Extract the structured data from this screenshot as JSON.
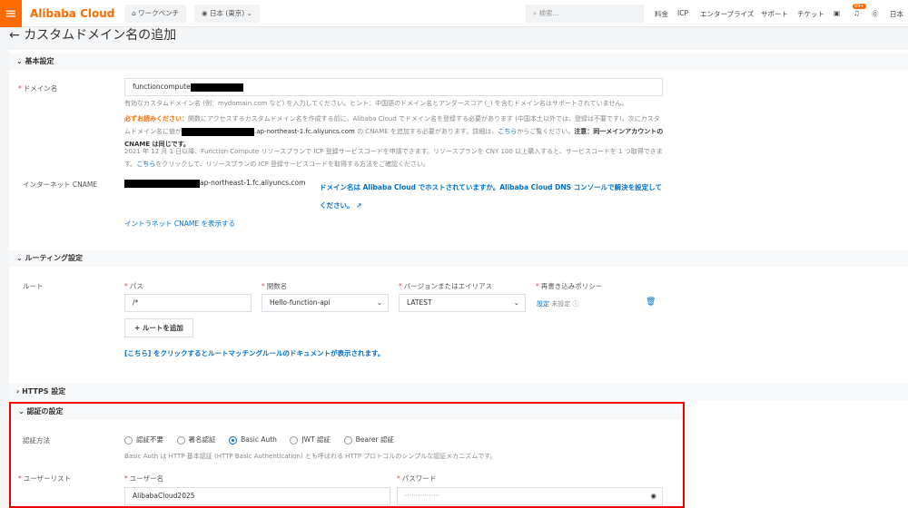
{
  "header": {
    "logo": "Alibaba Cloud",
    "workbench": "ワークベンチ",
    "region": "日本 (東京)",
    "search_placeholder": "検索...",
    "nav": [
      "料金",
      "ICP",
      "エンタープライズ",
      "サポート",
      "チケット"
    ],
    "badge": "99+",
    "lang": "日本"
  },
  "page": {
    "title": "カスタムドメイン名の追加"
  },
  "basic": {
    "title": "基本設定",
    "domain_label": "ドメイン名",
    "domain_value": "functioncompute",
    "hint": "有効なカスタムドメイン名 (例：mydomain.com など) を入力してください。ヒント：中国語のドメイン名とアンダースコア (_) を含むドメイン名はサポートされていません。",
    "warn_title": "必ずお読みください：",
    "warn_1": "関数にアクセスするカスタムドメイン名を作成する前に、Alibaba Cloud でドメイン名を登録する必要があります (中国本土以外では、登録は不要です)。次にカスタムドメイン名に値が",
    "warn_2": ".ap-northeast-1.fc.aliyuncs.com",
    "warn_3": " の CNAME を追加する必要があります。詳細は、",
    "warn_link": "こちら",
    "warn_4": "からご覧ください。",
    "warn_note": "注意：同一メインアカウントの CNAME は同じです。",
    "icp_1": "2021 年 12 月 1 日以降、Function Compute リソースプランで ICP 登録サービスコードを申請できます。リソースプランを CNY 100 以上購入すると、サービスコードを 1 つ取得できます。",
    "icp_link": "こちら",
    "icp_2": "をクリックして、リソースプランの ICP 登録サービスコードを取得する方法をご確認ください。",
    "cname_label": "インターネット CNAME",
    "cname_value": "ap-northeast-1.fc.aliyuncs.com",
    "cname_link": "ドメイン名は Alibaba Cloud でホストされていますか。Alibaba Cloud DNS コンソールで解決を設定してください。",
    "intranet_link": "イントラネット CNAME を表示する"
  },
  "routing": {
    "title": "ルーティング設定",
    "route_label": "ルート",
    "path_label": "パス",
    "path_value": "/*",
    "func_label": "関数名",
    "func_value": "Hello-function-api",
    "version_label": "バージョンまたはエイリアス",
    "version_value": "LATEST",
    "rewrite_label": "再書き込みポリシー",
    "rewrite_set": "設定",
    "rewrite_state": "未設定",
    "add_route": "ルートを追加",
    "doc_link": "[こちら] をクリックするとルートマッチングルールのドキュメントが表示されます。"
  },
  "https": {
    "title": "HTTPS 設定"
  },
  "auth": {
    "title": "認証の設定",
    "method_label": "認証方法",
    "options": [
      "認証不要",
      "署名認証",
      "Basic Auth",
      "JWT 認証",
      "Bearer 認証"
    ],
    "selected": "Basic Auth",
    "desc": "Basic Auth は HTTP 基本認証 (HTTP Basic Authentication) とも呼ばれる HTTP プロトコルのシンプルな認証メカニズムです。",
    "userlist_label": "ユーザーリスト",
    "username_label": "ユーザー名",
    "username_value": "AlibabaCloud2025",
    "password_label": "パスワード",
    "password_value": "················"
  },
  "colors": {
    "brand": "#ff6a00",
    "link": "#0070cc",
    "highlight": "#e00000"
  }
}
